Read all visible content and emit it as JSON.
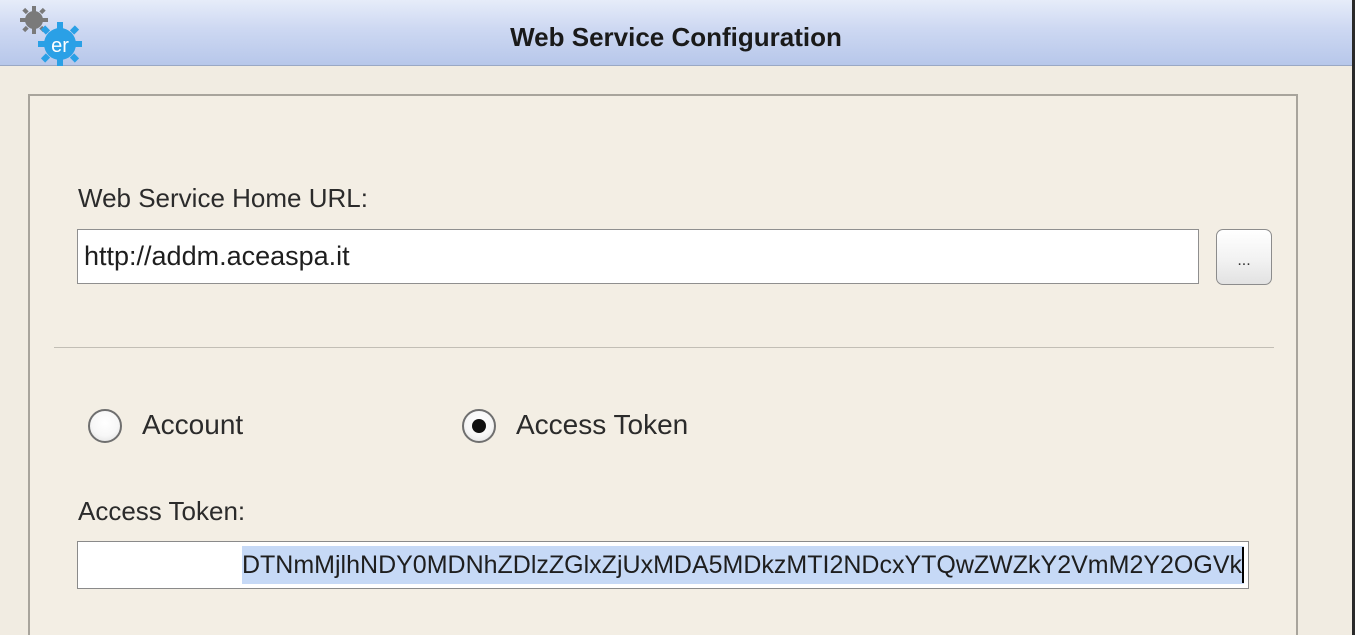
{
  "window": {
    "title": "Web Service Configuration",
    "icon": "er-gear-logo-icon",
    "icon_text": "er"
  },
  "form": {
    "home_url_label": "Web Service Home URL:",
    "home_url_value": "http://addm.aceaspa.it",
    "browse_button_label": "...",
    "auth_options": [
      {
        "label": "Account",
        "selected": false
      },
      {
        "label": "Access Token",
        "selected": true
      }
    ],
    "access_token_label": "Access Token:",
    "access_token_value": "DTNmMjlhNDY0MDNhZDlzZGlxZjUxMDA5MDkzMTI2NDcxYTQwZWZkY2VmM2Y2OGVk"
  },
  "colors": {
    "titlebar_top": "#e6ecf9",
    "titlebar_bottom": "#b7c7ea",
    "window_background": "#f1ece2",
    "selection_highlight": "#c6d9f6",
    "logo_gray": "#7a7a7a",
    "logo_blue": "#2aa0e6"
  }
}
